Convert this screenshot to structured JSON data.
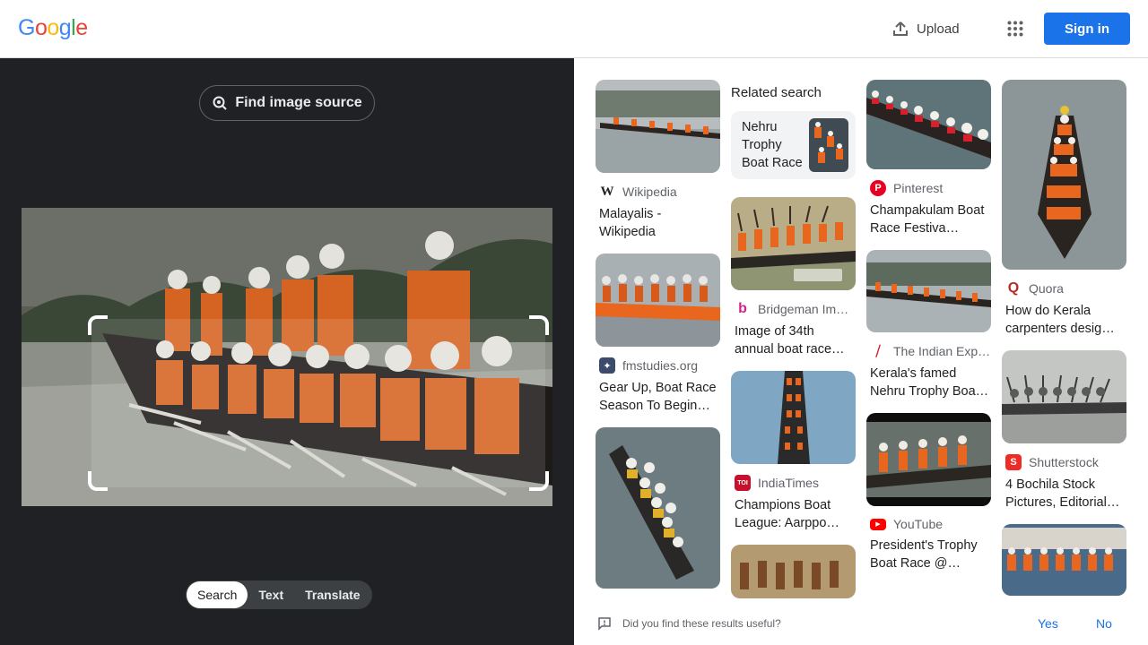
{
  "header": {
    "logo": [
      "G",
      "o",
      "o",
      "g",
      "l",
      "e"
    ],
    "upload_label": "Upload",
    "signin_label": "Sign in"
  },
  "left": {
    "find_source_label": "Find image source",
    "modes": [
      "Search",
      "Text",
      "Translate"
    ],
    "active_mode": "Search"
  },
  "results": {
    "related_heading": "Related search",
    "related_query": "Nehru Trophy Boat Race",
    "items": [
      {
        "source": "Wikipedia",
        "title": "Malayalis - Wikipedia",
        "icon": "wikipedia-icon"
      },
      {
        "source": "fmstudies.org",
        "title": "Gear Up, Boat Race Season To Begin…",
        "icon": "fmstudies-icon"
      },
      {
        "source": "Bridgeman Im…",
        "title": "Image of 34th annual boat race…",
        "icon": "bridgeman-icon"
      },
      {
        "source": "IndiaTimes",
        "title": "Champions Boat League: Aarppo…",
        "icon": "indiatimes-icon"
      },
      {
        "source": "Pinterest",
        "title": "Champakulam Boat Race Festiva…",
        "icon": "pinterest-icon"
      },
      {
        "source": "The Indian Exp…",
        "title": "Kerala's famed Nehru Trophy Boa…",
        "icon": "indian-express-icon"
      },
      {
        "source": "YouTube",
        "title": "President's Trophy Boat Race @…",
        "icon": "youtube-icon"
      },
      {
        "source": "Quora",
        "title": "How do Kerala carpenters desig…",
        "icon": "quora-icon"
      },
      {
        "source": "Shutterstock",
        "title": "4 Bochila Stock Pictures, Editorial…",
        "icon": "shutterstock-icon"
      }
    ]
  },
  "feedback": {
    "question": "Did you find these results useful?",
    "yes": "Yes",
    "no": "No"
  },
  "colors": {
    "accent": "#1a73e8",
    "dark_panel": "#202124",
    "boat_orange": "#e8661e"
  }
}
